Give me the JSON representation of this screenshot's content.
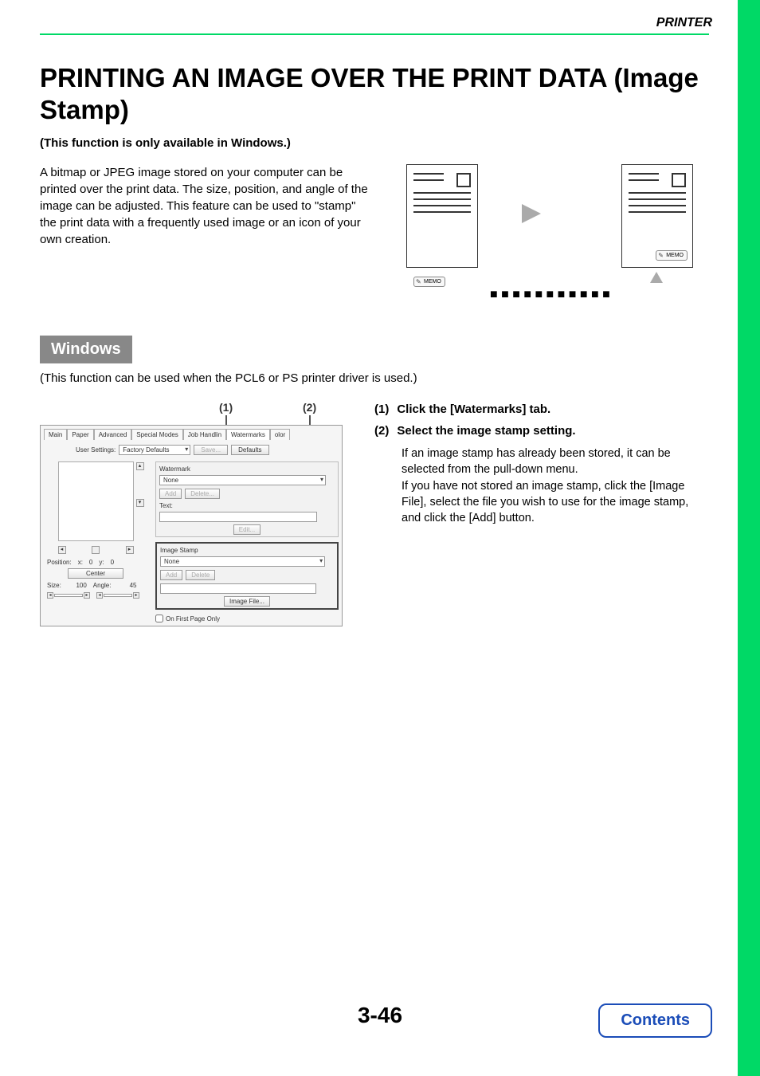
{
  "header": {
    "section": "PRINTER"
  },
  "title": "PRINTING AN IMAGE OVER THE PRINT DATA (Image Stamp)",
  "subnote": "(This function is only available in Windows.)",
  "intro": "A bitmap or JPEG image stored on your computer can be printed over the print data. The size, position, and angle of the image can be adjusted. This feature can be used to \"stamp\" the print data with a frequently used image or an icon of your own creation.",
  "memo_label": "MEMO",
  "section": {
    "tag": "Windows",
    "sub": "(This function can be used when the PCL6 or PS printer driver is used.)"
  },
  "callouts": {
    "c1": "(1)",
    "c2": "(2)"
  },
  "dialog": {
    "tabs": [
      "Main",
      "Paper",
      "Advanced",
      "Special Modes",
      "Job Handlin",
      "Watermarks",
      "olor"
    ],
    "user_settings_label": "User Settings:",
    "user_settings_value": "Factory Defaults",
    "save_btn": "Save...",
    "defaults_btn": "Defaults",
    "watermark": {
      "label": "Watermark",
      "value": "None",
      "add": "Add",
      "delete": "Delete...",
      "text_label": "Text:",
      "edit": "Edit..."
    },
    "image_stamp": {
      "label": "Image Stamp",
      "value": "None",
      "add": "Add",
      "delete": "Delete",
      "image_file": "Image File..."
    },
    "on_first_page": "On First Page Only",
    "position_label": "Position:",
    "position_x_label": "x:",
    "position_x_value": "0",
    "position_y_label": "y:",
    "position_y_value": "0",
    "center_btn": "Center",
    "size_label": "Size:",
    "size_value": "100",
    "angle_label": "Angle:",
    "angle_value": "45"
  },
  "steps": {
    "s1_num": "(1)",
    "s1_title": "Click the [Watermarks] tab.",
    "s2_num": "(2)",
    "s2_title": "Select the image stamp setting.",
    "s2_body": "If an image stamp has already been stored, it can be selected from the pull-down menu.\nIf you have not stored an image stamp, click the [Image File], select the file you wish to use for the image stamp, and click the [Add] button."
  },
  "page_number": "3-46",
  "contents_btn": "Contents"
}
